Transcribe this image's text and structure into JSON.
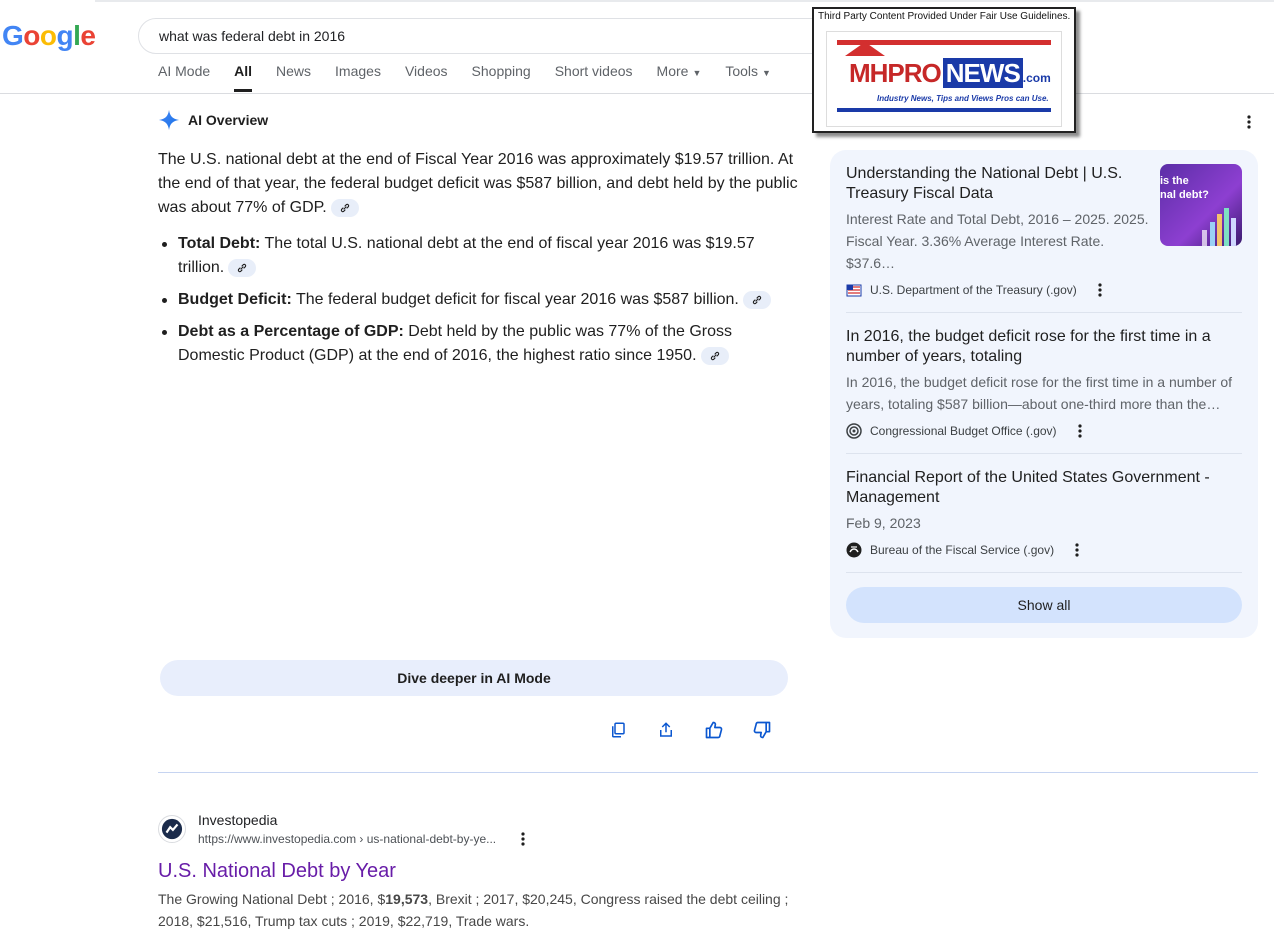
{
  "search": {
    "query": "what was federal debt in 2016"
  },
  "logo": {
    "letters": [
      "G",
      "o",
      "o",
      "g",
      "l",
      "e"
    ],
    "colors": [
      "#4285f4",
      "#ea4335",
      "#fbbc05",
      "#4285f4",
      "#34a853",
      "#ea4335"
    ]
  },
  "tabs": [
    {
      "label": "AI Mode"
    },
    {
      "label": "All"
    },
    {
      "label": "News"
    },
    {
      "label": "Images"
    },
    {
      "label": "Videos"
    },
    {
      "label": "Shopping"
    },
    {
      "label": "Short videos"
    },
    {
      "label": "More"
    },
    {
      "label": "Tools"
    }
  ],
  "ai_overview": {
    "header": "AI Overview",
    "intro": "The U.S. national debt at the end of Fiscal Year 2016 was approximately $19.57 trillion. At the end of that year, the federal budget deficit was $587 billion, and debt held by the public was about 77% of GDP.",
    "bullets": [
      {
        "label": "Total Debt:",
        "text": " The total U.S. national debt at the end of fiscal year 2016 was $19.57 trillion."
      },
      {
        "label": "Budget Deficit:",
        "text": " The federal budget deficit for fiscal year 2016 was $587 billion."
      },
      {
        "label": "Debt as a Percentage of GDP:",
        "text": " Debt held by the public was 77% of the Gross Domestic Product (GDP) at the end of 2016, the highest ratio since 1950."
      }
    ],
    "dive_deeper": "Dive deeper in AI Mode"
  },
  "sources": [
    {
      "title": "Understanding the National Debt | U.S. Treasury Fiscal Data",
      "desc": "Interest Rate and Total Debt, 2016 – 2025. 2025. Fiscal Year. 3.36% Average Interest Rate. $37.6…",
      "site": "U.S. Department of the Treasury (.gov)",
      "thumb_text": "is the\nnal debt?"
    },
    {
      "title": "In 2016, the budget deficit rose for the first time in a number of years, totaling",
      "desc": "In 2016, the budget deficit rose for the first time in a number of years, totaling $587 billion—about one-third more than the…",
      "site": "Congressional Budget Office (.gov)"
    },
    {
      "title": "Financial Report of the United States Government - Management",
      "desc": "Feb 9, 2023",
      "site": "Bureau of the Fiscal Service (.gov)"
    }
  ],
  "show_all": "Show all",
  "result": {
    "site": "Investopedia",
    "url": "https://www.investopedia.com › us-national-debt-by-ye...",
    "title": "U.S. National Debt by Year",
    "snippet_pre": "The Growing National Debt ; 2016, $",
    "snippet_bold": "19,573",
    "snippet_post": ", Brexit ; 2017, $20,245, Congress raised the debt ceiling ; 2018, $21,516, Trump tax cuts ; 2019, $22,719, Trade wars."
  },
  "overlay": {
    "caption": "Third Party Content Provided Under Fair Use Guidelines.",
    "brand_mh": "MHPRO",
    "brand_news": "NEWS",
    "brand_com": ".com",
    "tagline": "Industry News, Tips and Views Pros can Use."
  }
}
